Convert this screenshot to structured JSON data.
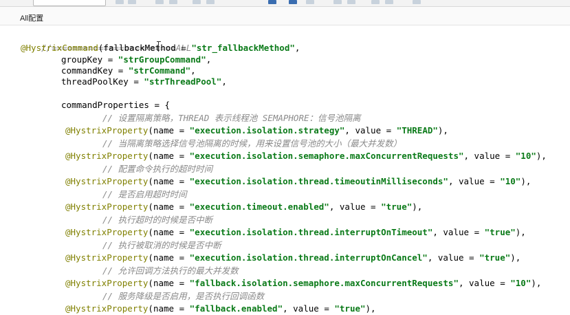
{
  "tab": {
    "title": "All配置"
  },
  "code": {
    "l0": [
      "//========================ALL"
    ],
    "l1": [
      "@HystrixCommand",
      "(fallbackMethod = ",
      "\"str_fallbackMethod\"",
      ","
    ],
    "l2": [
      "groupKey = ",
      "\"strGroupCommand\"",
      ","
    ],
    "l3": [
      "commandKey = ",
      "\"strCommand\"",
      ","
    ],
    "l4": [
      "threadPoolKey = ",
      "\"strThreadPool\"",
      ","
    ],
    "l5": [
      "commandProperties = {"
    ],
    "c1": "// 设置隔离策略，THREAD 表示线程池 SEMAPHORE：信号池隔离",
    "p1": [
      "@HystrixProperty",
      "(name = ",
      "\"execution.isolation.strategy\"",
      ", value = ",
      "\"THREAD\"",
      "),"
    ],
    "c2": "// 当隔离策略选择信号池隔离的时候，用来设置信号池的大小（最大并发数）",
    "p2": [
      "@HystrixProperty",
      "(name = ",
      "\"execution.isolation.semaphore.maxConcurrentRequests\"",
      ", value = ",
      "\"10\"",
      "),"
    ],
    "c3": "// 配置命令执行的超时时间",
    "p3": [
      "@HystrixProperty",
      "(name = ",
      "\"execution.isolation.thread.timeoutinMilliseconds\"",
      ", value = ",
      "\"10\"",
      "),"
    ],
    "c4": "// 是否启用超时时间",
    "p4": [
      "@HystrixProperty",
      "(name = ",
      "\"execution.timeout.enabled\"",
      ", value = ",
      "\"true\"",
      "),"
    ],
    "c5": "// 执行超时的时候是否中断",
    "p5": [
      "@HystrixProperty",
      "(name = ",
      "\"execution.isolation.thread.interruptOnTimeout\"",
      ", value = ",
      "\"true\"",
      "),"
    ],
    "c6": "// 执行被取消的时候是否中断",
    "p6": [
      "@HystrixProperty",
      "(name = ",
      "\"execution.isolation.thread.interruptOnCancel\"",
      ", value = ",
      "\"true\"",
      "),"
    ],
    "c7": "// 允许回调方法执行的最大并发数",
    "p7": [
      "@HystrixProperty",
      "(name = ",
      "\"fallback.isolation.semaphore.maxConcurrentRequests\"",
      ", value = ",
      "\"10\"",
      "),"
    ],
    "c8": "// 服务降级是否启用，是否执行回调函数",
    "p8": [
      "@HystrixProperty",
      "(name = ",
      "\"fallback.enabled\"",
      ", value = ",
      "\"true\"",
      "),"
    ]
  }
}
